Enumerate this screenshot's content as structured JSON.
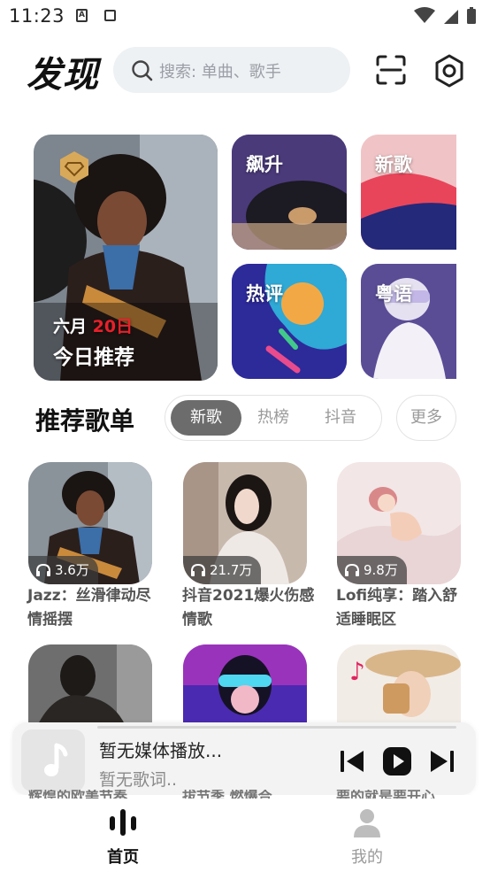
{
  "status_bar": {
    "time": "11:23",
    "notification_icon_letter": "A"
  },
  "header": {
    "title": "发现",
    "search_placeholder": "搜索: 单曲、歌手"
  },
  "feature_tiles": {
    "daily": {
      "month": "六月",
      "day": "20日",
      "label": "今日推荐"
    },
    "surge": {
      "label": "飙升"
    },
    "new_songs": {
      "label": "新歌"
    },
    "hot_comments": {
      "label": "热评"
    },
    "cantonese": {
      "label": "粤语"
    }
  },
  "playlists_section": {
    "title": "推荐歌单",
    "tabs": [
      "新歌",
      "热榜",
      "抖音"
    ],
    "active_tab": "新歌",
    "more_label": "更多",
    "cards": [
      {
        "plays": "3.6万",
        "title": "Jazz：丝滑律动尽情摇摆"
      },
      {
        "plays": "21.7万",
        "title": "抖音2021爆火伤感情歌"
      },
      {
        "plays": "9.8万",
        "title": "Lofi纯享：踏入舒适睡眠区"
      }
    ],
    "second_row_partial_titles": [
      "辉煌的欧美节奏",
      "拔节季 燃爆合",
      "要的就是要开心"
    ]
  },
  "player": {
    "title": "暂无媒体播放...",
    "lyrics": "暂无歌词.."
  },
  "bottom_nav": {
    "items": [
      {
        "label": "首页",
        "active": true
      },
      {
        "label": "我的",
        "active": false
      }
    ]
  },
  "colors": {
    "accent_red": "#e8202a",
    "active_tab_bg": "#6c6c6c",
    "search_bg": "#eef1f4"
  }
}
